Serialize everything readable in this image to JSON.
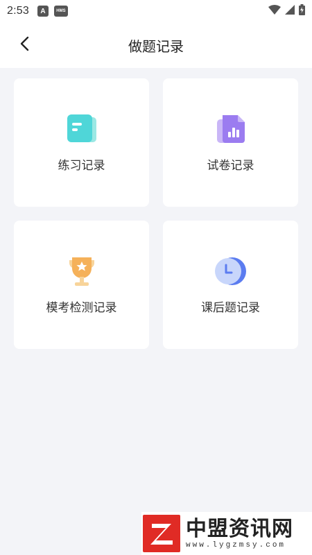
{
  "status_bar": {
    "time": "2:53",
    "icon_a_label": "A",
    "icon_hms_label": "HMS"
  },
  "header": {
    "title": "做题记录"
  },
  "cards": [
    {
      "label": "练习记录",
      "icon": "practice-doc-icon",
      "color": "#4fd6d8"
    },
    {
      "label": "试卷记录",
      "icon": "exam-paper-chart-icon",
      "color": "#9b7cf0"
    },
    {
      "label": "模考检测记录",
      "icon": "trophy-icon",
      "color": "#f5b15a"
    },
    {
      "label": "课后题记录",
      "icon": "clock-icon",
      "color": "#5b7cf0"
    }
  ],
  "watermark": {
    "name": "中盟资讯网",
    "url": "www.lygzmsy.com",
    "logo_letter": "Z",
    "brand_color": "#e02b25"
  }
}
